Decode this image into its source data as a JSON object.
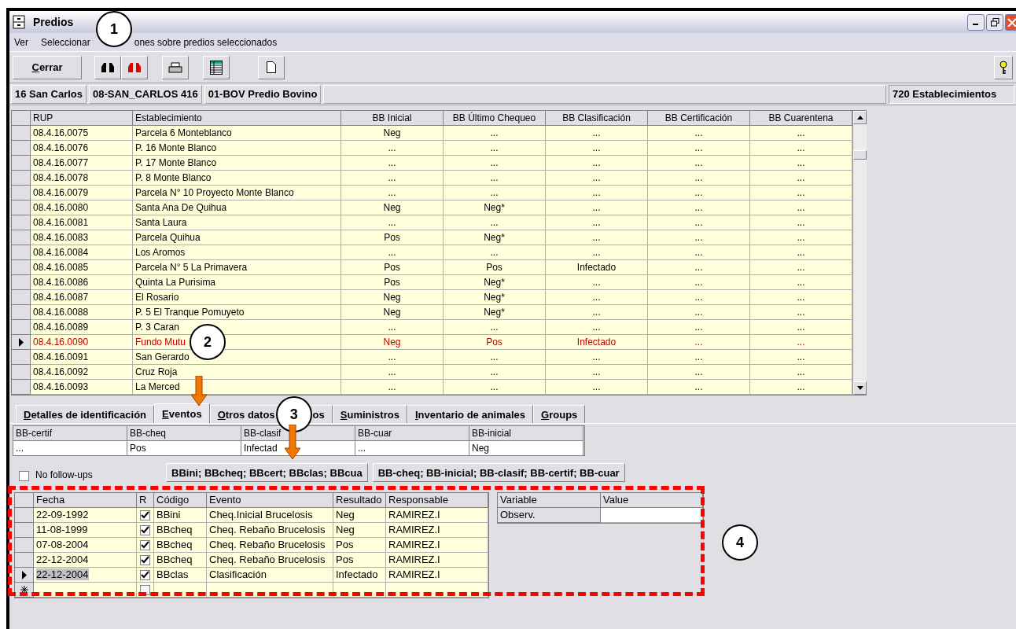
{
  "window": {
    "title": "Predios"
  },
  "menu": [
    "Ver",
    "Seleccionar",
    "ones sobre predios seleccionados"
  ],
  "toolbar": {
    "close_button": "Cerrar"
  },
  "info_bar": {
    "fields": [
      "16 San Carlos",
      "08-SAN_CARLOS 416",
      "01-BOV Predio Bovino"
    ],
    "count": "720 Establecimientos"
  },
  "predios_table": {
    "columns": [
      "RUP",
      "Establecimiento",
      "BB Inicial",
      "BB Último Chequeo",
      "BB Clasificación",
      "BB Certificación",
      "BB Cuarentena"
    ],
    "rows": [
      {
        "cells": [
          "08.4.16.0075",
          "Parcela 6 Monteblanco",
          "Neg",
          "...",
          "...",
          "...",
          "..."
        ],
        "selected": false
      },
      {
        "cells": [
          "08.4.16.0076",
          "P. 16 Monte Blanco",
          "...",
          "...",
          "...",
          "...",
          "..."
        ],
        "selected": false
      },
      {
        "cells": [
          "08.4.16.0077",
          "P. 17 Monte Blanco",
          "...",
          "...",
          "...",
          "...",
          "..."
        ],
        "selected": false
      },
      {
        "cells": [
          "08.4.16.0078",
          "P. 8 Monte Blanco",
          "...",
          "...",
          "...",
          "...",
          "..."
        ],
        "selected": false
      },
      {
        "cells": [
          "08.4.16.0079",
          "Parcela N° 10 Proyecto Monte Blanco",
          "...",
          "...",
          "...",
          "...",
          "..."
        ],
        "selected": false
      },
      {
        "cells": [
          "08.4.16.0080",
          "Santa Ana De Quihua",
          "Neg",
          "Neg*",
          "...",
          "...",
          "..."
        ],
        "selected": false
      },
      {
        "cells": [
          "08.4.16.0081",
          "Santa Laura",
          "...",
          "...",
          "...",
          "...",
          "..."
        ],
        "selected": false
      },
      {
        "cells": [
          "08.4.16.0083",
          "Parcela Quihua",
          "Pos",
          "Neg*",
          "...",
          "...",
          "..."
        ],
        "selected": false
      },
      {
        "cells": [
          "08.4.16.0084",
          "Los Aromos",
          "...",
          "...",
          "...",
          "...",
          "..."
        ],
        "selected": false
      },
      {
        "cells": [
          "08.4.16.0085",
          "Parcela N° 5 La Primavera",
          "Pos",
          "Pos",
          "Infectado",
          "...",
          "..."
        ],
        "selected": false
      },
      {
        "cells": [
          "08.4.16.0086",
          "Quinta La Purisima",
          "Pos",
          "Neg*",
          "...",
          "...",
          "..."
        ],
        "selected": false
      },
      {
        "cells": [
          "08.4.16.0087",
          "El Rosario",
          "Neg",
          "Neg*",
          "...",
          "...",
          "..."
        ],
        "selected": false
      },
      {
        "cells": [
          "08.4.16.0088",
          "P. 5 El Tranque Pomuyeto",
          "Neg",
          "Neg*",
          "...",
          "...",
          "..."
        ],
        "selected": false
      },
      {
        "cells": [
          "08.4.16.0089",
          "P. 3 Caran",
          "...",
          "...",
          "...",
          "...",
          "..."
        ],
        "selected": false
      },
      {
        "cells": [
          "08.4.16.0090",
          "Fundo Mutu",
          "Neg",
          "Pos",
          "Infectado",
          "...",
          "..."
        ],
        "selected": true
      },
      {
        "cells": [
          "08.4.16.0091",
          "San Gerardo",
          "...",
          "...",
          "...",
          "...",
          "..."
        ],
        "selected": false
      },
      {
        "cells": [
          "08.4.16.0092",
          "Cruz Roja",
          "...",
          "...",
          "...",
          "...",
          "..."
        ],
        "selected": false
      },
      {
        "cells": [
          "08.4.16.0093",
          "La Merced",
          "...",
          "...",
          "...",
          "...",
          "..."
        ],
        "selected": false
      }
    ]
  },
  "tabs": [
    {
      "label": "Detalles de identificación",
      "selected": false
    },
    {
      "label": "Eventos",
      "selected": true
    },
    {
      "label": "Otros datos",
      "label_end": "os",
      "selected": false
    },
    {
      "label": "Suministros",
      "selected": false
    },
    {
      "label": "Inventario de animales",
      "selected": false
    },
    {
      "label": "Groups",
      "selected": false
    }
  ],
  "summary_table": {
    "columns": [
      "BB-certif",
      "BB-cheq",
      "BB-clasif",
      "BB-cuar",
      "BB-inicial"
    ],
    "values": [
      "...",
      "Pos",
      "Infectad",
      "...",
      "Neg"
    ]
  },
  "no_followups": {
    "label": "No follow-ups",
    "checked": false
  },
  "filter_buttons": [
    "BBini; BBcheq; BBcert; BBclas; BBcua",
    "BB-cheq; BB-inicial; BB-clasif; BB-certif; BB-cuar"
  ],
  "events_table": {
    "columns": [
      "Fecha",
      "R",
      "Código",
      "Evento",
      "Resultado",
      "Responsable"
    ],
    "rows": [
      {
        "fecha": "22-09-1992",
        "r": true,
        "codigo": "BBini",
        "evento": "Cheq.Inicial Brucelosis",
        "resultado": "Neg",
        "responsable": "RAMIREZ.I",
        "selected": false
      },
      {
        "fecha": "11-08-1999",
        "r": true,
        "codigo": "BBcheq",
        "evento": "Cheq. Rebaño Brucelosis",
        "resultado": "Neg",
        "responsable": "RAMIREZ.I",
        "selected": false
      },
      {
        "fecha": "07-08-2004",
        "r": true,
        "codigo": "BBcheq",
        "evento": "Cheq. Rebaño Brucelosis",
        "resultado": "Pos",
        "responsable": "RAMIREZ.I",
        "selected": false
      },
      {
        "fecha": "22-12-2004",
        "r": true,
        "codigo": "BBcheq",
        "evento": "Cheq. Rebaño Brucelosis",
        "resultado": "Pos",
        "responsable": "RAMIREZ.I",
        "selected": false
      },
      {
        "fecha": "22-12-2004",
        "r": true,
        "codigo": "BBclas",
        "evento": "Clasificación",
        "resultado": "Infectado",
        "responsable": "RAMIREZ.I",
        "selected": true
      }
    ],
    "new_row_r": false
  },
  "variables_table": {
    "columns": [
      "Variable",
      "Value"
    ],
    "rows": [
      {
        "variable": "Observ.",
        "value": ""
      }
    ]
  },
  "callouts": [
    "1",
    "2",
    "3",
    "4"
  ]
}
